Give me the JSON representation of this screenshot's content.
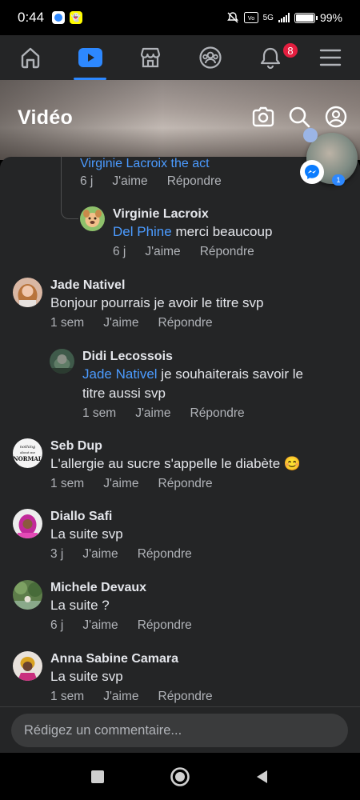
{
  "status_bar": {
    "time": "0:44",
    "network_label": "5G",
    "battery_label": "99%",
    "battery_fraction": 0.99,
    "icons": [
      "messenger-notification-icon",
      "snapchat-notification-icon",
      "mute-icon",
      "volte-icon",
      "signal-icon",
      "battery-icon"
    ]
  },
  "nav": {
    "tabs": [
      {
        "name": "home",
        "icon": "home-icon"
      },
      {
        "name": "video",
        "icon": "video-icon",
        "active": true
      },
      {
        "name": "marketplace",
        "icon": "marketplace-icon"
      },
      {
        "name": "groups",
        "icon": "groups-icon"
      },
      {
        "name": "notifications",
        "icon": "bell-icon",
        "badge": "8"
      },
      {
        "name": "menu",
        "icon": "menu-icon"
      }
    ],
    "notifications_badge": "8"
  },
  "header": {
    "title": "Vidéo",
    "icons": [
      "camera-icon",
      "search-icon",
      "profile-icon"
    ]
  },
  "comments": {
    "partial_top": {
      "text": "Virginie Lacroix the act",
      "time": "6 j",
      "like": "J'aime",
      "reply": "Répondre"
    },
    "items": [
      {
        "author": "Virginie Lacroix",
        "mention": "Del Phine",
        "text": " merci beaucoup",
        "time": "6 j",
        "like": "J'aime",
        "reply": "Répondre",
        "reply_level": 1
      },
      {
        "author": "Jade Nativel",
        "mention": "",
        "text": "Bonjour pourrais je avoir le titre svp",
        "time": "1 sem",
        "like": "J'aime",
        "reply": "Répondre",
        "reply_level": 0
      },
      {
        "author": "Didi Lecossois",
        "mention": "Jade Nativel",
        "text": " je souhaiterais savoir le titre aussi svp",
        "time": "1 sem",
        "like": "J'aime",
        "reply": "Répondre",
        "reply_level": 1
      },
      {
        "author": "Seb Dup",
        "mention": "",
        "text": "L'allergie au sucre s'appelle le diabète 😊",
        "time": "1 sem",
        "like": "J'aime",
        "reply": "Répondre",
        "reply_level": 0
      },
      {
        "author": "Diallo Safi",
        "mention": "",
        "text": "La suite svp",
        "time": "3 j",
        "like": "J'aime",
        "reply": "Répondre",
        "reply_level": 0
      },
      {
        "author": "Michele Devaux",
        "mention": "",
        "text": "La suite ?",
        "time": "6 j",
        "like": "J'aime",
        "reply": "Répondre",
        "reply_level": 0
      },
      {
        "author": "Anna Sabine Camara",
        "mention": "",
        "text": "La suite svp",
        "time": "1 sem",
        "like": "J'aime",
        "reply": "Répondre",
        "reply_level": 0
      }
    ]
  },
  "composer": {
    "placeholder": "Rédigez un commentaire..."
  },
  "chat_head": {
    "unread": "1"
  },
  "system_nav": {
    "icons": [
      "recents-square-icon",
      "home-circle-icon",
      "back-triangle-icon"
    ]
  },
  "colors": {
    "background": "#242526",
    "accent": "#2d88ff",
    "mention": "#4b9bff",
    "badge": "#e41e3f",
    "secondary_text": "#b0b3b8"
  }
}
